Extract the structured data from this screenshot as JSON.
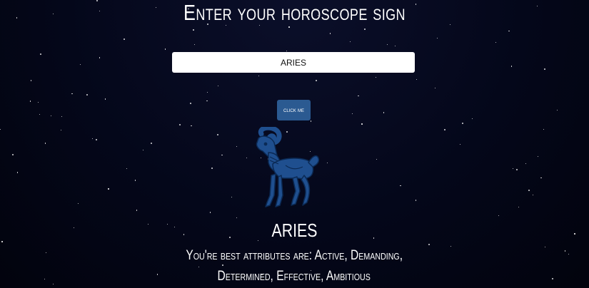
{
  "page": {
    "heading": "Enter your horoscope sign",
    "background_color": "#04071a"
  },
  "form": {
    "sign_input_value": "ARIES",
    "button_label": "click me",
    "button_color": "#2b5a91"
  },
  "result": {
    "icon": "aries-ram-icon",
    "icon_color": "#1f4f8f",
    "sign_name": "ARIES",
    "attributes_line1": "You're best attributes are: Active, Demanding,",
    "attributes_line2": "Determined, Effective, Ambitious"
  }
}
